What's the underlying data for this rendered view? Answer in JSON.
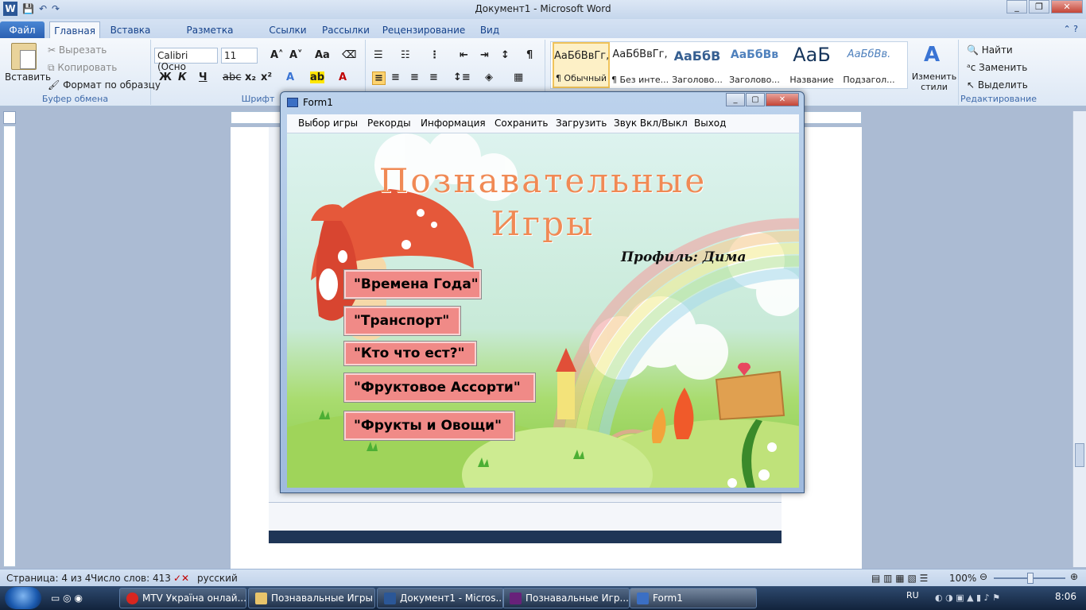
{
  "word": {
    "title": "Документ1 - Microsoft Word",
    "tabs": [
      "Файл",
      "Главная",
      "Вставка",
      "Разметка страницы",
      "Ссылки",
      "Рассылки",
      "Рецензирование",
      "Вид"
    ],
    "clipboard": {
      "paste": "Вставить",
      "cut": "Вырезать",
      "copy": "Копировать",
      "format_painter": "Формат по образцу",
      "group": "Буфер обмена"
    },
    "font": {
      "name": "Calibri (Осно",
      "size": "11",
      "group": "Шрифт"
    },
    "styles": [
      {
        "preview": "АаБбВвГг,",
        "label": "¶ Обычный"
      },
      {
        "preview": "АаБбВвГг,",
        "label": "¶ Без инте..."
      },
      {
        "preview": "АаБбВ",
        "label": "Заголово..."
      },
      {
        "preview": "АаБбВв",
        "label": "Заголово..."
      },
      {
        "preview": "АаБ",
        "label": "Название"
      },
      {
        "preview": "АаБбВв.",
        "label": "Подзагол..."
      }
    ],
    "change_styles": "Изменить стили",
    "editing": {
      "find": "Найти",
      "replace": "Заменить",
      "select": "Выделить",
      "group": "Редактирование"
    },
    "status": {
      "page": "Страница: 4 из 4",
      "words": "Число слов: 413",
      "language": "русский",
      "zoom": "100%"
    }
  },
  "form": {
    "title": "Form1",
    "menu": [
      "Выбор игры",
      "Рекорды",
      "Информация",
      "Сохранить",
      "Загрузить",
      "Звук Вкл/Выкл",
      "Выход"
    ],
    "heading_line1": "Познавательные",
    "heading_line2": "Игры",
    "profile": "Профиль: Дима",
    "games": [
      "\"Времена Года\"",
      "\"Транспорт\"",
      "\"Кто что ест?\"",
      "\"Фруктовое Ассорти\"",
      "\"Фрукты и Овощи\""
    ]
  },
  "taskbar": {
    "items": [
      "MTV Україна онлай...",
      "Познавальные Игры",
      "Документ1 - Micros...",
      "Познавальные Игр...",
      "Form1"
    ],
    "language": "RU",
    "time": "8:06"
  }
}
